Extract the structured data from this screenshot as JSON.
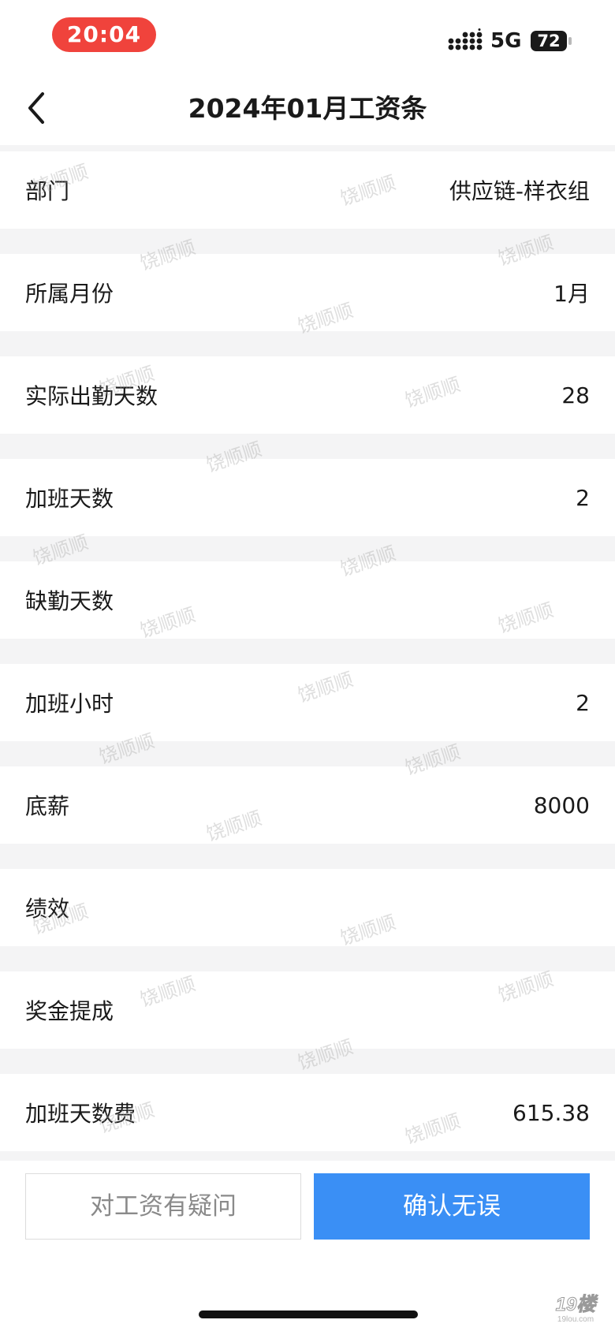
{
  "status_bar": {
    "time": "20:04",
    "network": "5G",
    "battery": "72",
    "time_pill_color": "#f0433c"
  },
  "nav": {
    "back_icon": "chevron-left-icon",
    "title": "2024年01月工资条"
  },
  "rows": [
    {
      "label": "部门",
      "value": "供应链-样衣组"
    },
    {
      "label": "所属月份",
      "value": "1月"
    },
    {
      "label": "实际出勤天数",
      "value": "28"
    },
    {
      "label": "加班天数",
      "value": "2"
    },
    {
      "label": "缺勤天数",
      "value": ""
    },
    {
      "label": "加班小时",
      "value": "2"
    },
    {
      "label": "底薪",
      "value": "8000"
    },
    {
      "label": "绩效",
      "value": ""
    },
    {
      "label": "奖金提成",
      "value": ""
    },
    {
      "label": "加班天数费",
      "value": "615.38"
    }
  ],
  "watermark_text": "饶顺顺",
  "actions": {
    "question_label": "对工资有疑问",
    "confirm_label": "确认无误",
    "confirm_color": "#3a8ff5"
  },
  "corner_logo": {
    "main": "19楼",
    "sub": "19lou.com"
  }
}
